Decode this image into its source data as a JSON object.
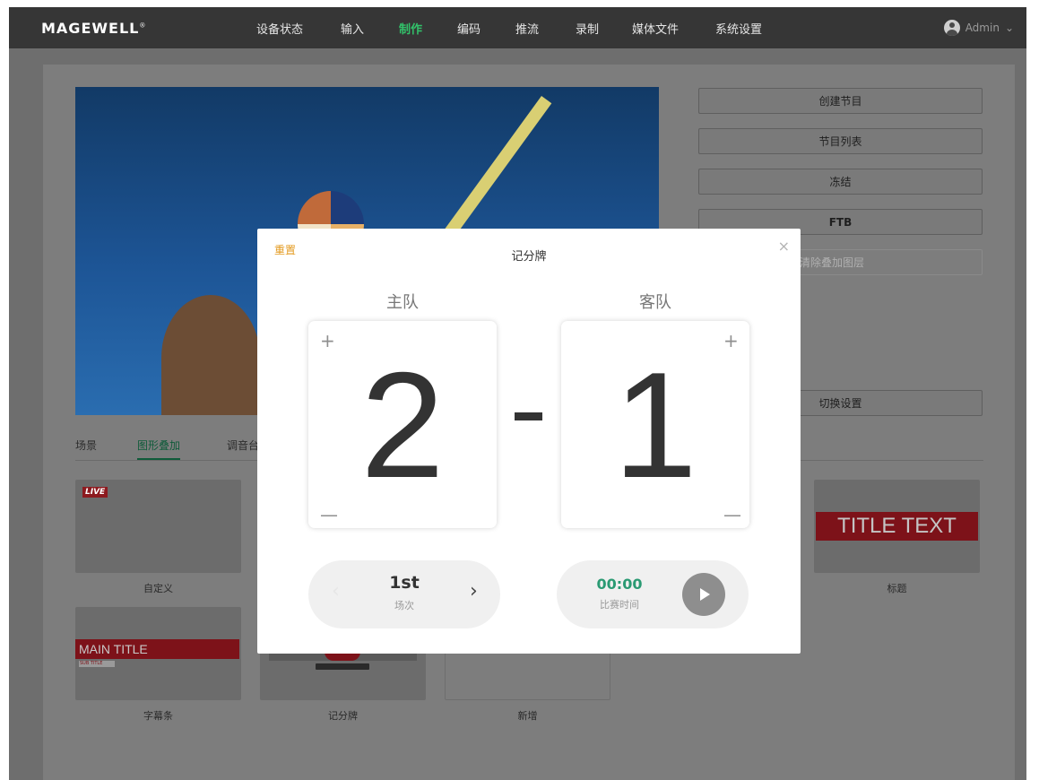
{
  "header": {
    "logo": "MAGEWELL",
    "logo_mark": "®",
    "nav": [
      {
        "label": "设备状态",
        "active": false
      },
      {
        "label": "输入",
        "active": false
      },
      {
        "label": "制作",
        "active": true
      },
      {
        "label": "编码",
        "active": false
      },
      {
        "label": "推流",
        "active": false
      },
      {
        "label": "录制",
        "active": false
      },
      {
        "label": "媒体文件",
        "active": false
      },
      {
        "label": "系统设置",
        "active": false
      }
    ],
    "user": "Admin",
    "user_chevron": "⌄",
    "accent_color": "#32c26a"
  },
  "sidebar": {
    "buttons": [
      "创建节目",
      "节目列表",
      "冻结",
      "FTB",
      "清除叠加图层",
      "切换设置"
    ]
  },
  "tabs": [
    {
      "label": "场景",
      "active": false
    },
    {
      "label": "图形叠加",
      "active": true
    },
    {
      "label": "调音台",
      "active": false
    }
  ],
  "overlays": [
    {
      "label": "自定义",
      "badge": "LIVE"
    },
    {
      "label": "标题",
      "text": "TITLE TEXT"
    },
    {
      "label": "字幕条",
      "text": "MAIN TITLE",
      "subtext": "SUB TITLE"
    },
    {
      "label": "记分牌"
    },
    {
      "label": "新增"
    }
  ],
  "modal": {
    "reset": "重置",
    "title": "记分牌",
    "close": "×",
    "home": {
      "label": "主队",
      "score": "2"
    },
    "away": {
      "label": "客队",
      "score": "1"
    },
    "plus": "+",
    "minus": "—",
    "round": {
      "value": "1st",
      "label": "场次",
      "next": "›",
      "prev": "‹"
    },
    "timer": {
      "value": "00:00",
      "label": "比赛时间"
    },
    "reset_color": "#e39a1f",
    "timer_color": "#2a9a73"
  }
}
